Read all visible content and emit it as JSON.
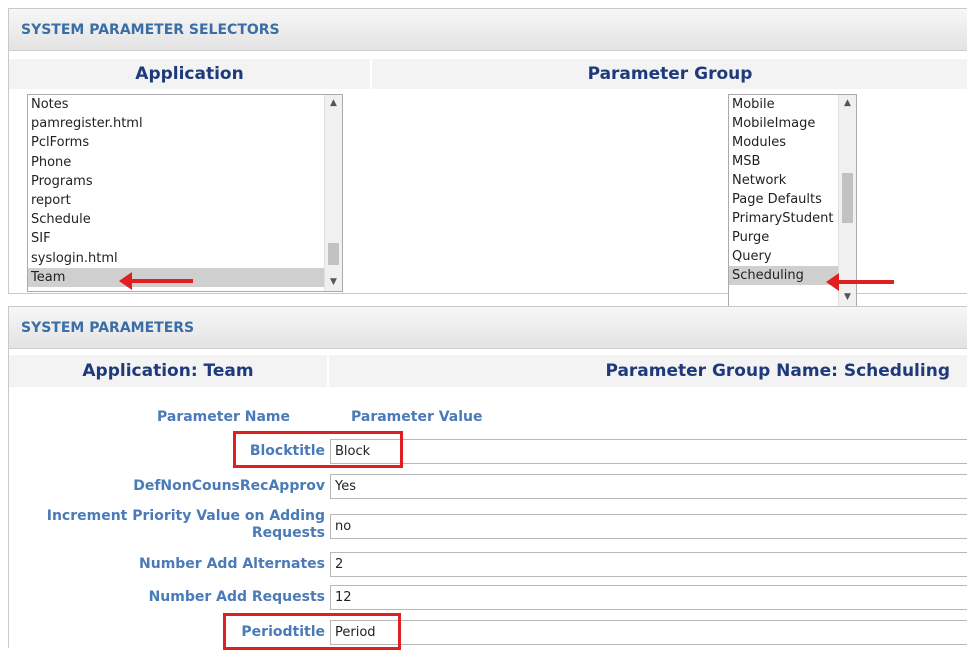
{
  "selectors": {
    "header": "SYSTEM PARAMETER SELECTORS",
    "application_label": "Application",
    "parameter_group_label": "Parameter Group",
    "applications": [
      "Notes",
      "pamregister.html",
      "PclForms",
      "Phone",
      "Programs",
      "report",
      "Schedule",
      "SIF",
      "syslogin.html",
      "Team"
    ],
    "selected_application": "Team",
    "parameter_groups": [
      "Mobile",
      "MobileImage",
      "Modules",
      "MSB",
      "Network",
      "Page Defaults",
      "PrimaryStudent",
      "Purge",
      "Query",
      "Scheduling"
    ],
    "selected_parameter_group": "Scheduling"
  },
  "parameters": {
    "header": "SYSTEM PARAMETERS",
    "application_heading": "Application: Team",
    "group_heading": "Parameter Group Name: Scheduling",
    "col_name": "Parameter Name",
    "col_value": "Parameter Value",
    "rows": [
      {
        "name": "Blocktitle",
        "value": "Block"
      },
      {
        "name": "DefNonCounsRecApprov",
        "value": "Yes"
      },
      {
        "name": "Increment Priority Value on Adding Requests",
        "value": "no"
      },
      {
        "name": "Number Add Alternates",
        "value": "2"
      },
      {
        "name": "Number Add Requests",
        "value": "12"
      },
      {
        "name": "Periodtitle",
        "value": "Period"
      }
    ]
  },
  "colors": {
    "accent_blue": "#3a6ea5",
    "dark_blue": "#1e3a7a",
    "label_blue": "#4a7ab8",
    "highlight_red": "#e02020"
  }
}
